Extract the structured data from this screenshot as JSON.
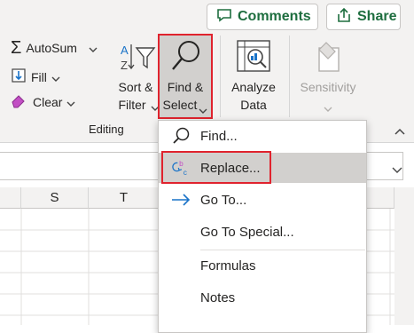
{
  "header": {
    "comments_label": "Comments",
    "share_label": "Share"
  },
  "editing_group": {
    "autosum_label": "AutoSum",
    "fill_label": "Fill",
    "clear_label": "Clear",
    "sort_filter_line1": "Sort &",
    "sort_filter_line2": "Filter",
    "find_select_line1": "Find &",
    "find_select_line2": "Select",
    "group_label": "Editing"
  },
  "analysis_group": {
    "analyze_line1": "Analyze",
    "analyze_line2": "Data"
  },
  "sensitivity_group": {
    "sensitivity_label": "Sensitivity"
  },
  "grid": {
    "columns": [
      "S",
      "T"
    ]
  },
  "find_menu": {
    "items": [
      {
        "label": "Find..."
      },
      {
        "label": "Replace..."
      },
      {
        "label": "Go To..."
      },
      {
        "label": "Go To Special..."
      },
      {
        "label": "Formulas"
      },
      {
        "label": "Notes"
      }
    ]
  },
  "colors": {
    "accent_green": "#1e6e3f",
    "highlight_red": "#e0232e",
    "selected_bg": "#d2d0ce"
  }
}
